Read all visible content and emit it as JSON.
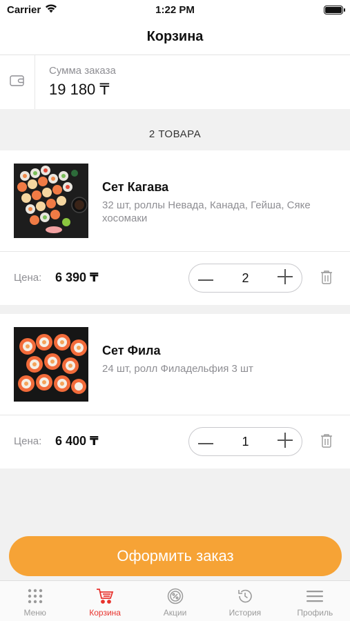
{
  "status_bar": {
    "carrier": "Carrier",
    "time": "1:22 PM"
  },
  "nav": {
    "title": "Корзина"
  },
  "summary": {
    "label": "Сумма заказа",
    "value": "19 180 ₸"
  },
  "items_count": "2 ТОВАРА",
  "cart_items": [
    {
      "name": "Сет Кагава",
      "description": "32 шт, роллы Невада, Канада, Гейша, Сяке хосомаки",
      "price_label": "Цена:",
      "price": "6 390 ₸",
      "quantity": "2"
    },
    {
      "name": "Сет Фила",
      "description": "24 шт, ролл Филадельфия 3 шт",
      "price_label": "Цена:",
      "price": "6 400 ₸",
      "quantity": "1"
    }
  ],
  "checkout": {
    "label": "Оформить заказ"
  },
  "tabs": [
    {
      "label": "Меню",
      "icon": "grid-icon",
      "active": false
    },
    {
      "label": "Корзина",
      "icon": "cart-icon",
      "active": true
    },
    {
      "label": "Акции",
      "icon": "percent-badge-icon",
      "active": false
    },
    {
      "label": "История",
      "icon": "history-icon",
      "active": false
    },
    {
      "label": "Профиль",
      "icon": "menu-icon",
      "active": false
    }
  ],
  "colors": {
    "accent": "#f6a336",
    "active_tab": "#e8322c",
    "muted_text": "#8e8e93",
    "background": "#f1f1f1"
  }
}
